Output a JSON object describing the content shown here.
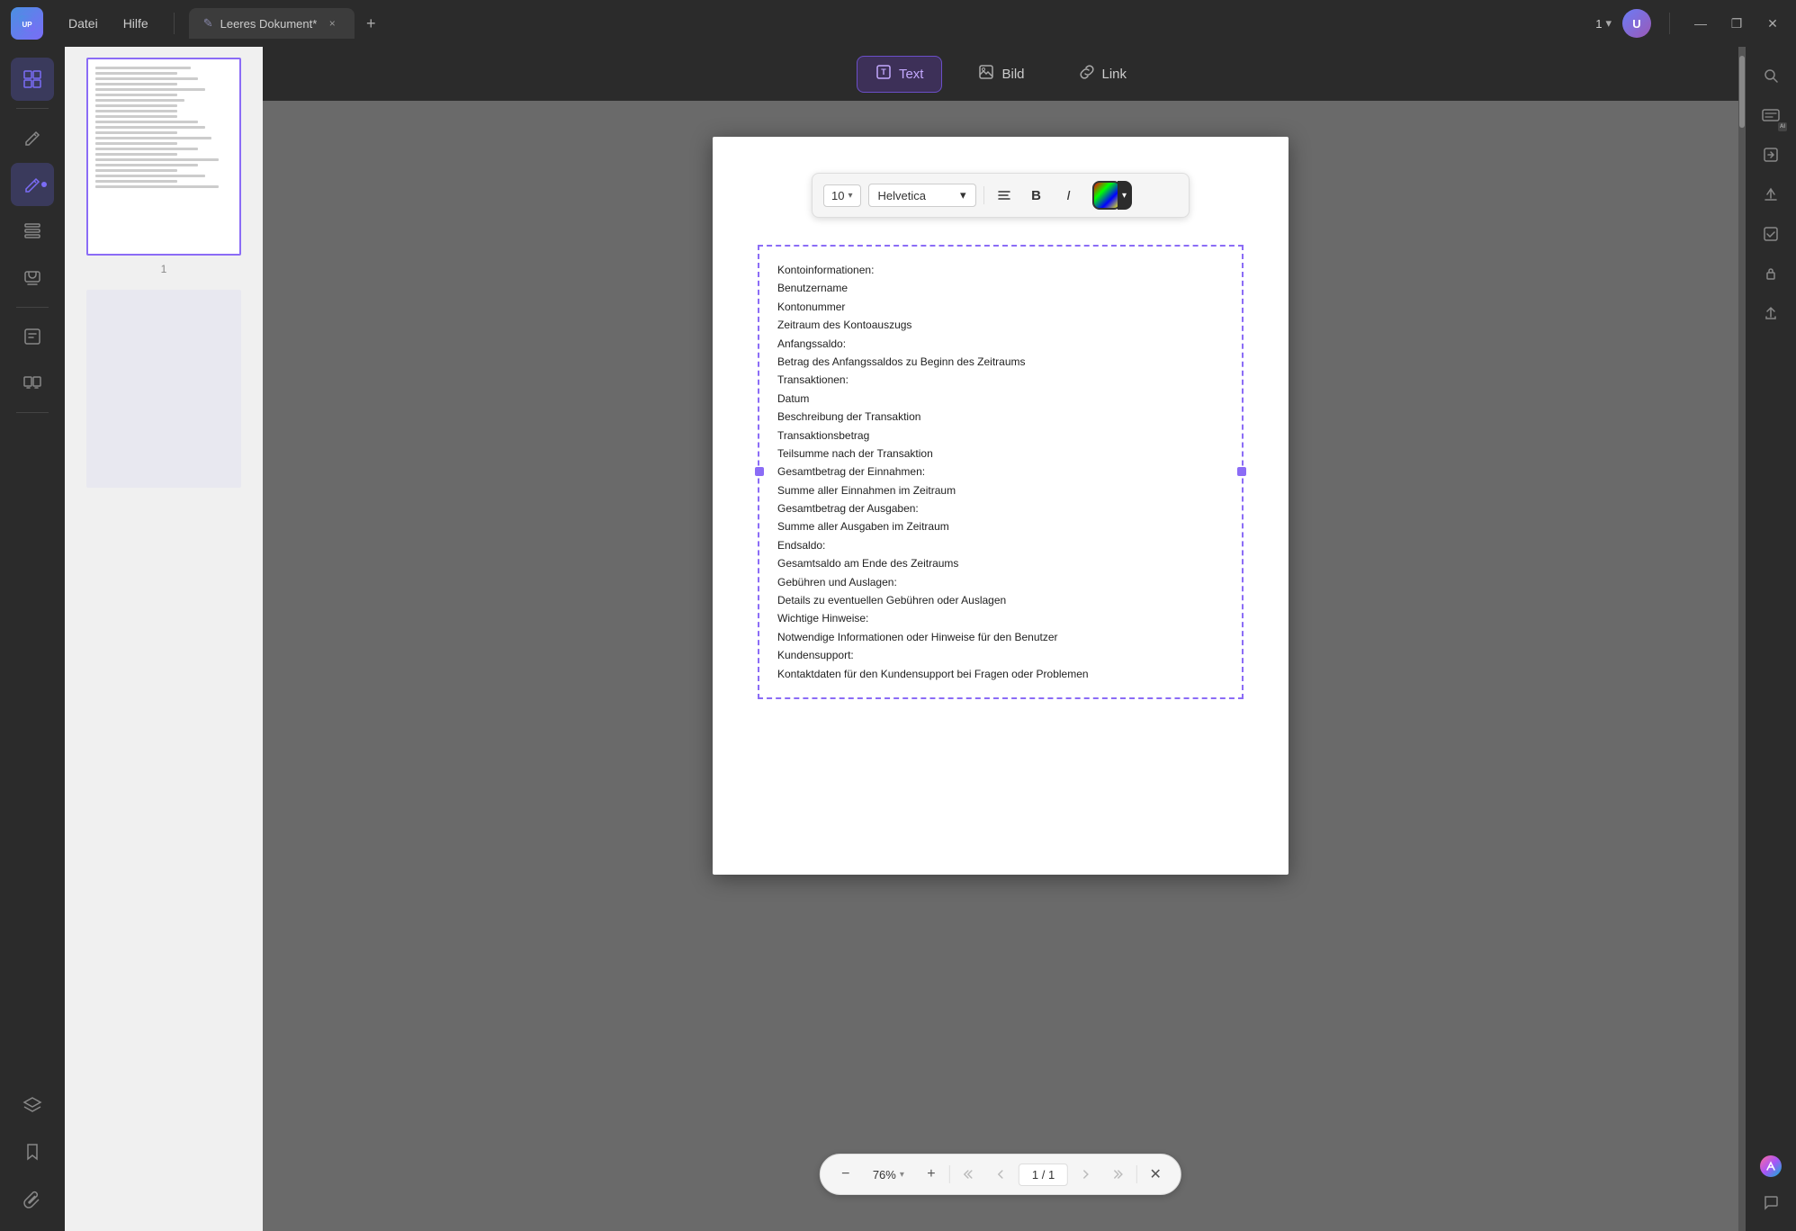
{
  "app": {
    "name": "UPDF",
    "logo_text": "UPDF"
  },
  "title_bar": {
    "menu_items": [
      "Datei",
      "Hilfe"
    ],
    "tab_title": "Leeres Dokument*",
    "tab_close": "×",
    "tab_add": "+",
    "page_display": "1",
    "window_minimize": "—",
    "window_maximize": "❐",
    "window_close": "✕",
    "user_initial": "U"
  },
  "toolbar": {
    "text_btn": "Text",
    "bild_btn": "Bild",
    "link_btn": "Link"
  },
  "format_bar": {
    "font_size": "10",
    "font_family": "Helvetica",
    "align_icon": "≡",
    "bold_icon": "B",
    "italic_icon": "I"
  },
  "document": {
    "page_number": "1",
    "text_lines": [
      "Kontoinformationen:",
      "Benutzername",
      "Kontonummer",
      "Zeitraum des Kontoauszugs",
      "Anfangssaldo:",
      "Betrag des Anfangssaldos zu Beginn des Zeitraums",
      "Transaktionen:",
      "Datum",
      "Beschreibung der Transaktion",
      "Transaktionsbetrag",
      "Teilsumme nach der Transaktion",
      "Gesamtbetrag der Einnahmen:",
      "Summe aller Einnahmen im Zeitraum",
      "Gesamtbetrag der Ausgaben:",
      "Summe aller Ausgaben im Zeitraum",
      "Endsaldo:",
      "Gesamtsaldo am Ende des Zeitraums",
      "Gebühren und Auslagen:",
      "Details zu eventuellen Gebühren oder Auslagen",
      "Wichtige Hinweise:",
      "Notwendige Informationen oder Hinweise für den Benutzer",
      "Kundensupport:",
      "Kontaktdaten für den Kundensupport bei Fragen oder Problemen"
    ]
  },
  "bottom_toolbar": {
    "zoom_out": "−",
    "zoom_level": "76%",
    "zoom_in": "+",
    "page_first": "⏫",
    "page_prev": "▲",
    "page_display": "1 / 1",
    "page_next": "▼",
    "page_last": "⏬",
    "close": "✕"
  },
  "sidebar_left": {
    "icons": [
      {
        "name": "thumbnails",
        "symbol": "⊞",
        "active": true
      },
      {
        "name": "edit",
        "symbol": "✏",
        "active": false
      },
      {
        "name": "annotate",
        "symbol": "✏",
        "active": true
      },
      {
        "name": "table-of-contents",
        "symbol": "☰",
        "active": false
      },
      {
        "name": "stamp",
        "symbol": "⊕",
        "active": false
      },
      {
        "name": "form",
        "symbol": "▤",
        "active": false
      },
      {
        "name": "organize",
        "symbol": "⊟",
        "active": false
      }
    ]
  },
  "sidebar_right": {
    "icons": [
      {
        "name": "search",
        "symbol": "🔍"
      },
      {
        "name": "ocr",
        "symbol": "OCR"
      },
      {
        "name": "convert",
        "symbol": "↕"
      },
      {
        "name": "save",
        "symbol": "↑"
      },
      {
        "name": "check",
        "symbol": "✓"
      },
      {
        "name": "protect",
        "symbol": "🔒"
      },
      {
        "name": "share",
        "symbol": "↗"
      },
      {
        "name": "ai",
        "symbol": "✦"
      },
      {
        "name": "comment",
        "symbol": "💬"
      }
    ]
  },
  "colors": {
    "sidebar_bg": "#2b2b2b",
    "toolbar_bg": "#2b2b2b",
    "active_tab_bg": "#3d3058",
    "active_tab_border": "#6b4fc8",
    "accent": "#8b6cf6",
    "canvas_bg": "#6a6a6a"
  }
}
